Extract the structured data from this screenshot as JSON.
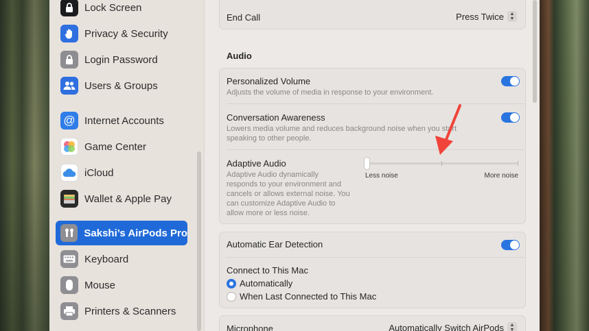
{
  "sidebar": {
    "items": [
      {
        "label": "Lock Screen",
        "icon": "lock-icon",
        "color": "#1c1c1e"
      },
      {
        "label": "Privacy & Security",
        "icon": "hand-icon",
        "color": "#2f6fe0"
      },
      {
        "label": "Login Password",
        "icon": "lock-icon",
        "color": "#8d8d92"
      },
      {
        "label": "Users & Groups",
        "icon": "users-icon",
        "color": "#2f6fe0"
      },
      {
        "label": "Internet Accounts",
        "icon": "at-icon",
        "color": "#2f7de8"
      },
      {
        "label": "Game Center",
        "icon": "game-center-icon",
        "color": "#e65e8a"
      },
      {
        "label": "iCloud",
        "icon": "cloud-icon",
        "color": "#3b8fe8"
      },
      {
        "label": "Wallet & Apple Pay",
        "icon": "wallet-icon",
        "color": "#2a2a2a"
      },
      {
        "label": "Sakshi’s AirPods Pro",
        "icon": "airpods-icon",
        "color": "#8e8e93"
      },
      {
        "label": "Keyboard",
        "icon": "keyboard-icon",
        "color": "#8e8e93"
      },
      {
        "label": "Mouse",
        "icon": "mouse-icon",
        "color": "#8e8e93"
      },
      {
        "label": "Printers & Scanners",
        "icon": "printer-icon",
        "color": "#8e8e93"
      }
    ]
  },
  "main": {
    "end_call": {
      "label": "End Call",
      "value": "Press Twice"
    },
    "audio_section": "Audio",
    "personalized_volume": {
      "label": "Personalized Volume",
      "desc": "Adjusts the volume of media in response to your environment.",
      "on": true
    },
    "conversation_awareness": {
      "label": "Conversation Awareness",
      "desc_line1": "Lowers media volume and reduces background noise when you start",
      "desc_line2": "speaking to other people.",
      "on": true
    },
    "adaptive_audio": {
      "label": "Adaptive Audio",
      "desc_lines": [
        "Adaptive Audio dynamically",
        "responds to your environment and",
        "cancels or allows external noise. You",
        "can customize Adaptive Audio to",
        "allow more or less noise."
      ],
      "min_label": "Less noise",
      "max_label": "More noise",
      "level": 0
    },
    "automatic_ear_detection": {
      "label": "Automatic Ear Detection",
      "on": true
    },
    "connect": {
      "label": "Connect to This Mac",
      "options": [
        "Automatically",
        "When Last Connected to This Mac"
      ],
      "selected": "Automatically"
    },
    "microphone": {
      "label": "Microphone",
      "value": "Automatically Switch AirPods"
    }
  },
  "colors": {
    "accent": "#2a74e0",
    "selected_sidebar": "#1f6ad8",
    "annotation_arrow": "#f0443a"
  }
}
